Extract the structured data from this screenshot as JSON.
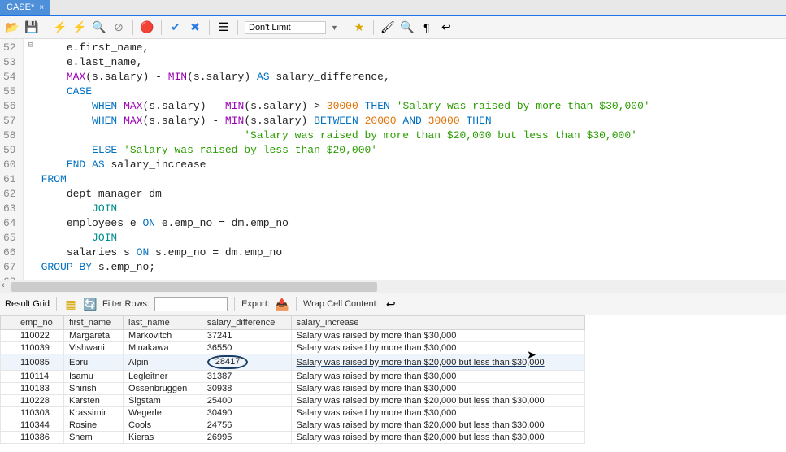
{
  "tab": {
    "label": "CASE*"
  },
  "toolbar": {
    "limit_value": "Don't Limit"
  },
  "code": {
    "lines": [
      {
        "n": 52,
        "frags": [
          {
            "t": "    e",
            "c": "plain"
          },
          {
            "t": ".",
            "c": "plain"
          },
          {
            "t": "first_name",
            "c": "plain"
          },
          {
            "t": ",",
            "c": "plain"
          }
        ]
      },
      {
        "n": 53,
        "frags": [
          {
            "t": "    e",
            "c": "plain"
          },
          {
            "t": ".",
            "c": "plain"
          },
          {
            "t": "last_name",
            "c": "plain"
          },
          {
            "t": ",",
            "c": "plain"
          }
        ]
      },
      {
        "n": 54,
        "frags": [
          {
            "t": "    ",
            "c": "plain"
          },
          {
            "t": "MAX",
            "c": "kw-purple"
          },
          {
            "t": "(s",
            "c": "plain"
          },
          {
            "t": ".",
            "c": "plain"
          },
          {
            "t": "salary) ",
            "c": "plain"
          },
          {
            "t": "- ",
            "c": "plain"
          },
          {
            "t": "MIN",
            "c": "kw-purple"
          },
          {
            "t": "(s",
            "c": "plain"
          },
          {
            "t": ".",
            "c": "plain"
          },
          {
            "t": "salary) ",
            "c": "plain"
          },
          {
            "t": "AS",
            "c": "kw-blue"
          },
          {
            "t": " salary_difference",
            "c": "plain"
          },
          {
            "t": ",",
            "c": "plain"
          }
        ]
      },
      {
        "n": 55,
        "frags": [
          {
            "t": "    ",
            "c": "plain"
          },
          {
            "t": "CASE",
            "c": "kw-blue"
          }
        ],
        "fold": "⊟"
      },
      {
        "n": 56,
        "frags": [
          {
            "t": "        ",
            "c": "plain"
          },
          {
            "t": "WHEN",
            "c": "kw-blue"
          },
          {
            "t": " ",
            "c": "plain"
          },
          {
            "t": "MAX",
            "c": "kw-purple"
          },
          {
            "t": "(s",
            "c": "plain"
          },
          {
            "t": ".",
            "c": "plain"
          },
          {
            "t": "salary) ",
            "c": "plain"
          },
          {
            "t": "- ",
            "c": "plain"
          },
          {
            "t": "MIN",
            "c": "kw-purple"
          },
          {
            "t": "(s",
            "c": "plain"
          },
          {
            "t": ".",
            "c": "plain"
          },
          {
            "t": "salary) ",
            "c": "plain"
          },
          {
            "t": "> ",
            "c": "plain"
          },
          {
            "t": "30000",
            "c": "kw-orange"
          },
          {
            "t": " ",
            "c": "plain"
          },
          {
            "t": "THEN",
            "c": "kw-blue"
          },
          {
            "t": " ",
            "c": "plain"
          },
          {
            "t": "'Salary was raised by more than $30,000'",
            "c": "str-green"
          }
        ]
      },
      {
        "n": 57,
        "frags": [
          {
            "t": "        ",
            "c": "plain"
          },
          {
            "t": "WHEN",
            "c": "kw-blue"
          },
          {
            "t": " ",
            "c": "plain"
          },
          {
            "t": "MAX",
            "c": "kw-purple"
          },
          {
            "t": "(s",
            "c": "plain"
          },
          {
            "t": ".",
            "c": "plain"
          },
          {
            "t": "salary) ",
            "c": "plain"
          },
          {
            "t": "- ",
            "c": "plain"
          },
          {
            "t": "MIN",
            "c": "kw-purple"
          },
          {
            "t": "(s",
            "c": "plain"
          },
          {
            "t": ".",
            "c": "plain"
          },
          {
            "t": "salary) ",
            "c": "plain"
          },
          {
            "t": "BETWEEN",
            "c": "kw-blue"
          },
          {
            "t": " ",
            "c": "plain"
          },
          {
            "t": "20000",
            "c": "kw-orange"
          },
          {
            "t": " ",
            "c": "plain"
          },
          {
            "t": "AND",
            "c": "kw-blue"
          },
          {
            "t": " ",
            "c": "plain"
          },
          {
            "t": "30000",
            "c": "kw-orange"
          },
          {
            "t": " ",
            "c": "plain"
          },
          {
            "t": "THEN",
            "c": "kw-blue"
          }
        ]
      },
      {
        "n": 58,
        "frags": [
          {
            "t": "                                ",
            "c": "plain"
          },
          {
            "t": "'Salary was raised by more than $20,000 but less than $30,000'",
            "c": "str-green"
          }
        ]
      },
      {
        "n": 59,
        "frags": [
          {
            "t": "        ",
            "c": "plain"
          },
          {
            "t": "ELSE",
            "c": "kw-blue"
          },
          {
            "t": " ",
            "c": "plain"
          },
          {
            "t": "'Salary was raised by less than $20,000'",
            "c": "str-green"
          }
        ]
      },
      {
        "n": 60,
        "frags": [
          {
            "t": "    ",
            "c": "plain"
          },
          {
            "t": "END",
            "c": "kw-blue"
          },
          {
            "t": " ",
            "c": "plain"
          },
          {
            "t": "AS",
            "c": "kw-blue"
          },
          {
            "t": " salary_increase",
            "c": "plain"
          }
        ]
      },
      {
        "n": 61,
        "frags": [
          {
            "t": "FROM",
            "c": "kw-blue"
          }
        ]
      },
      {
        "n": 62,
        "frags": [
          {
            "t": "    dept_manager dm",
            "c": "plain"
          }
        ]
      },
      {
        "n": 63,
        "frags": [
          {
            "t": "        ",
            "c": "plain"
          },
          {
            "t": "JOIN",
            "c": "kw-cyan"
          }
        ]
      },
      {
        "n": 64,
        "frags": [
          {
            "t": "    employees e ",
            "c": "plain"
          },
          {
            "t": "ON",
            "c": "kw-blue"
          },
          {
            "t": " e",
            "c": "plain"
          },
          {
            "t": ".",
            "c": "plain"
          },
          {
            "t": "emp_no ",
            "c": "plain"
          },
          {
            "t": "= dm",
            "c": "plain"
          },
          {
            "t": ".",
            "c": "plain"
          },
          {
            "t": "emp_no",
            "c": "plain"
          }
        ]
      },
      {
        "n": 65,
        "frags": [
          {
            "t": "        ",
            "c": "plain"
          },
          {
            "t": "JOIN",
            "c": "kw-cyan"
          }
        ]
      },
      {
        "n": 66,
        "frags": [
          {
            "t": "    salaries s ",
            "c": "plain"
          },
          {
            "t": "ON",
            "c": "kw-blue"
          },
          {
            "t": " s",
            "c": "plain"
          },
          {
            "t": ".",
            "c": "plain"
          },
          {
            "t": "emp_no ",
            "c": "plain"
          },
          {
            "t": "= dm",
            "c": "plain"
          },
          {
            "t": ".",
            "c": "plain"
          },
          {
            "t": "emp_no",
            "c": "plain"
          }
        ]
      },
      {
        "n": 67,
        "frags": [
          {
            "t": "GROUP BY",
            "c": "kw-blue"
          },
          {
            "t": " s",
            "c": "plain"
          },
          {
            "t": ".",
            "c": "plain"
          },
          {
            "t": "emp_no",
            "c": "plain"
          },
          {
            "t": ";",
            "c": "plain"
          }
        ]
      },
      {
        "n": 68,
        "frags": [
          {
            "t": " ",
            "c": "plain"
          }
        ]
      }
    ]
  },
  "results": {
    "title": "Result Grid",
    "filter_label": "Filter Rows:",
    "export_label": "Export:",
    "wrap_label": "Wrap Cell Content:",
    "columns": [
      "emp_no",
      "first_name",
      "last_name",
      "salary_difference",
      "salary_increase"
    ],
    "rows": [
      {
        "cells": [
          "110022",
          "Margareta",
          "Markovitch",
          "37241",
          "Salary was raised by more than $30,000"
        ]
      },
      {
        "cells": [
          "110039",
          "Vishwani",
          "Minakawa",
          "36550",
          "Salary was raised by more than $30,000"
        ]
      },
      {
        "cells": [
          "110085",
          "Ebru",
          "Alpin",
          "28417",
          "Salary was raised by more than $20,000 but less than $30,000"
        ],
        "hl": true,
        "circle_col": 3,
        "ul": true
      },
      {
        "cells": [
          "110114",
          "Isamu",
          "Legleitner",
          "31387",
          "Salary was raised by more than $30,000"
        ]
      },
      {
        "cells": [
          "110183",
          "Shirish",
          "Ossenbruggen",
          "30938",
          "Salary was raised by more than $30,000"
        ]
      },
      {
        "cells": [
          "110228",
          "Karsten",
          "Sigstam",
          "25400",
          "Salary was raised by more than $20,000 but less than $30,000"
        ]
      },
      {
        "cells": [
          "110303",
          "Krassimir",
          "Wegerle",
          "30490",
          "Salary was raised by more than $30,000"
        ]
      },
      {
        "cells": [
          "110344",
          "Rosine",
          "Cools",
          "24756",
          "Salary was raised by more than $20,000 but less than $30,000"
        ]
      },
      {
        "cells": [
          "110386",
          "Shem",
          "Kieras",
          "26995",
          "Salary was raised by more than $20,000 but less than $30,000"
        ]
      }
    ]
  }
}
